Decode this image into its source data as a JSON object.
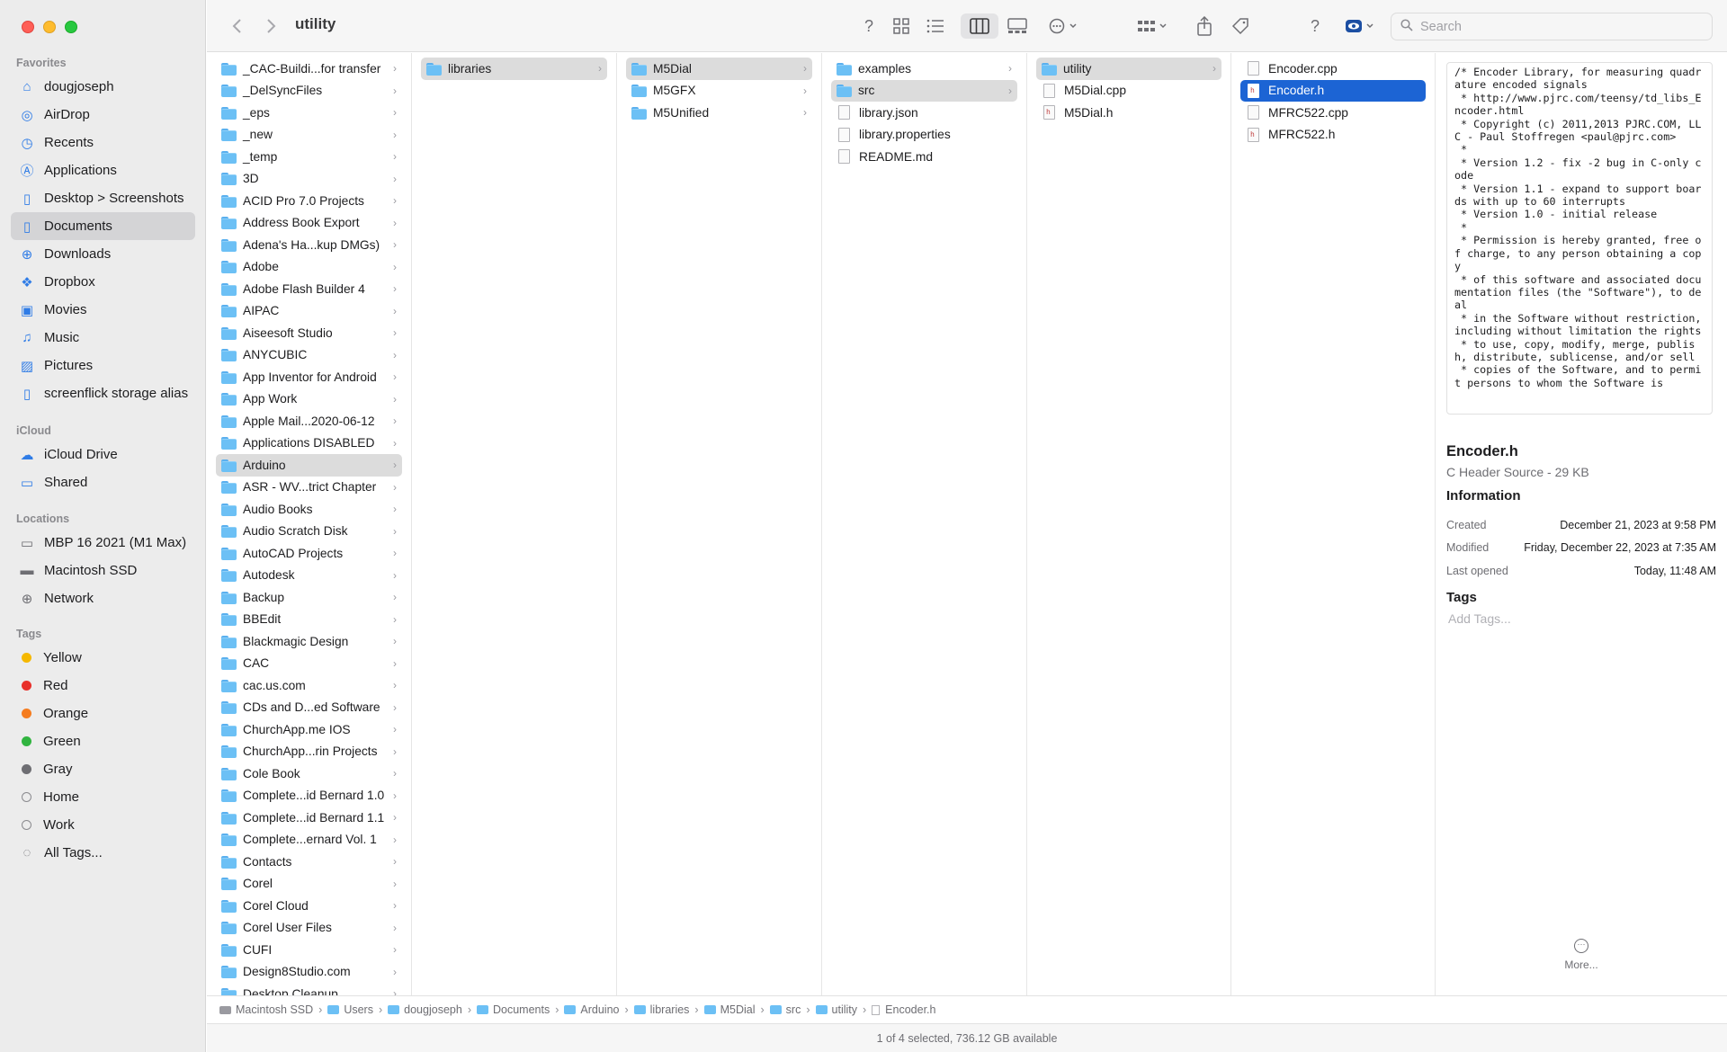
{
  "toolbar": {
    "title": "utility",
    "search_placeholder": "Search",
    "back_icon": "chevron-left-icon",
    "forward_icon": "chevron-right-icon"
  },
  "sidebar": {
    "favorites_heading": "Favorites",
    "favorites": [
      {
        "label": "dougjoseph",
        "icon": "home-icon"
      },
      {
        "label": "AirDrop",
        "icon": "airdrop-icon"
      },
      {
        "label": "Recents",
        "icon": "clock-icon"
      },
      {
        "label": "Applications",
        "icon": "applications-icon"
      },
      {
        "label": "Desktop > Screenshots",
        "icon": "document-icon"
      },
      {
        "label": "Documents",
        "icon": "document-icon"
      },
      {
        "label": "Downloads",
        "icon": "download-icon"
      },
      {
        "label": "Dropbox",
        "icon": "dropbox-icon"
      },
      {
        "label": "Movies",
        "icon": "film-icon"
      },
      {
        "label": "Music",
        "icon": "music-icon"
      },
      {
        "label": "Pictures",
        "icon": "photo-icon"
      },
      {
        "label": "screenflick storage alias",
        "icon": "document-icon"
      }
    ],
    "icloud_heading": "iCloud",
    "icloud": [
      {
        "label": "iCloud Drive",
        "icon": "cloud-icon"
      },
      {
        "label": "Shared",
        "icon": "shared-folder-icon"
      }
    ],
    "locations_heading": "Locations",
    "locations": [
      {
        "label": "MBP 16 2021 (M1 Max)",
        "icon": "laptop-icon"
      },
      {
        "label": "Macintosh SSD",
        "icon": "disk-icon"
      },
      {
        "label": "Network",
        "icon": "globe-icon"
      }
    ],
    "tags_heading": "Tags",
    "tags": [
      {
        "label": "Yellow",
        "color": "#f5b800"
      },
      {
        "label": "Red",
        "color": "#e8302a"
      },
      {
        "label": "Orange",
        "color": "#f57c1f"
      },
      {
        "label": "Green",
        "color": "#31b440"
      },
      {
        "label": "Gray",
        "color": "#6e6e73"
      },
      {
        "label": "Home",
        "color": ""
      },
      {
        "label": "Work",
        "color": ""
      },
      {
        "label": "All Tags...",
        "color": ""
      }
    ]
  },
  "columns": {
    "col1": [
      "_CAC-Buildi...for transfer",
      "_DelSyncFiles",
      "_eps",
      "_new",
      "_temp",
      "3D",
      "ACID Pro 7.0 Projects",
      "Address Book Export",
      "Adena's Ha...kup DMGs)",
      "Adobe",
      "Adobe Flash Builder 4",
      "AIPAC",
      "Aiseesoft Studio",
      "ANYCUBIC",
      "App Inventor for Android",
      "App Work",
      "Apple Mail...2020-06-12",
      "Applications DISABLED",
      "Arduino",
      "ASR - WV...trict Chapter",
      "Audio Books",
      "Audio Scratch Disk",
      "AutoCAD Projects",
      "Autodesk",
      "Backup",
      "BBEdit",
      "Blackmagic Design",
      "CAC",
      "cac.us.com",
      "CDs and D...ed Software",
      "ChurchApp.me IOS",
      "ChurchApp...rin Projects",
      "Cole Book",
      "Complete...id Bernard 1.0",
      "Complete...id Bernard 1.1",
      "Complete...ernard Vol. 1",
      "Contacts",
      "Corel",
      "Corel Cloud",
      "Corel User Files",
      "CUFI",
      "Design8Studio.com",
      "Desktop Cleanup"
    ],
    "col2": [
      "libraries"
    ],
    "col3": [
      "M5Dial",
      "M5GFX",
      "M5Unified"
    ],
    "col4": [
      {
        "name": "examples",
        "type": "folder"
      },
      {
        "name": "src",
        "type": "folder"
      },
      {
        "name": "library.json",
        "type": "file"
      },
      {
        "name": "library.properties",
        "type": "file"
      },
      {
        "name": "README.md",
        "type": "file"
      }
    ],
    "col5": [
      {
        "name": "utility",
        "type": "folder"
      },
      {
        "name": "M5Dial.cpp",
        "type": "file"
      },
      {
        "name": "M5Dial.h",
        "type": "hfile"
      }
    ],
    "col6": [
      {
        "name": "Encoder.cpp",
        "type": "file"
      },
      {
        "name": "Encoder.h",
        "type": "hfile"
      },
      {
        "name": "MFRC522.cpp",
        "type": "file"
      },
      {
        "name": "MFRC522.h",
        "type": "hfile"
      }
    ]
  },
  "preview": {
    "code": "/* Encoder Library, for measuring quadrature encoded signals\n * http://www.pjrc.com/teensy/td_libs_Encoder.html\n * Copyright (c) 2011,2013 PJRC.COM, LLC - Paul Stoffregen <paul@pjrc.com>\n *\n * Version 1.2 - fix -2 bug in C-only code\n * Version 1.1 - expand to support boards with up to 60 interrupts\n * Version 1.0 - initial release\n *\n * Permission is hereby granted, free of charge, to any person obtaining a copy\n * of this software and associated documentation files (the \"Software\"), to deal\n * in the Software without restriction, including without limitation the rights\n * to use, copy, modify, merge, publish, distribute, sublicense, and/or sell\n * copies of the Software, and to permit persons to whom the Software is",
    "name": "Encoder.h",
    "kind": "C Header Source - 29 KB",
    "info_heading": "Information",
    "created_label": "Created",
    "created_value": "December 21, 2023 at 9:58 PM",
    "modified_label": "Modified",
    "modified_value": "Friday, December 22, 2023 at 7:35 AM",
    "opened_label": "Last opened",
    "opened_value": "Today, 11:48 AM",
    "tags_heading": "Tags",
    "add_tags": "Add Tags...",
    "more_label": "More..."
  },
  "pathbar": [
    "Macintosh SSD",
    "Users",
    "dougjoseph",
    "Documents",
    "Arduino",
    "libraries",
    "M5Dial",
    "src",
    "utility",
    "Encoder.h"
  ],
  "status": "1 of 4 selected, 736.12 GB available"
}
